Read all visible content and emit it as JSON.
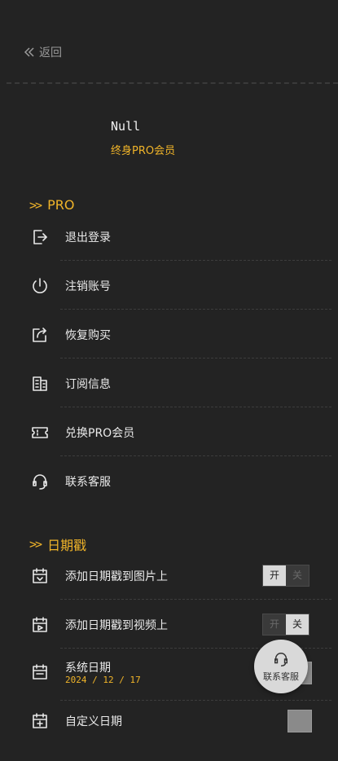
{
  "header": {
    "back_label": "返回"
  },
  "user": {
    "name": "Null",
    "membership": "终身PRO会员"
  },
  "pro_section": {
    "title": "PRO",
    "items": [
      {
        "label": "退出登录",
        "icon": "logout-icon"
      },
      {
        "label": "注销账号",
        "icon": "power-icon"
      },
      {
        "label": "恢复购买",
        "icon": "restore-icon"
      },
      {
        "label": "订阅信息",
        "icon": "subscription-info-icon"
      },
      {
        "label": "兑换PRO会员",
        "icon": "ticket-icon"
      },
      {
        "label": "联系客服",
        "icon": "headset-icon"
      }
    ]
  },
  "date_section": {
    "title": "日期戳",
    "items": [
      {
        "label": "添加日期戳到图片上",
        "toggle": {
          "on": "开",
          "off": "关",
          "state": "on"
        }
      },
      {
        "label": "添加日期戳到视频上",
        "toggle": {
          "on": "开",
          "off": "关",
          "state": "off"
        }
      },
      {
        "label": "系统日期",
        "value": "2024 / 12 / 17"
      },
      {
        "label": "自定义日期"
      }
    ]
  },
  "fab": {
    "label": "联系客服",
    "icon": "headset-icon"
  }
}
